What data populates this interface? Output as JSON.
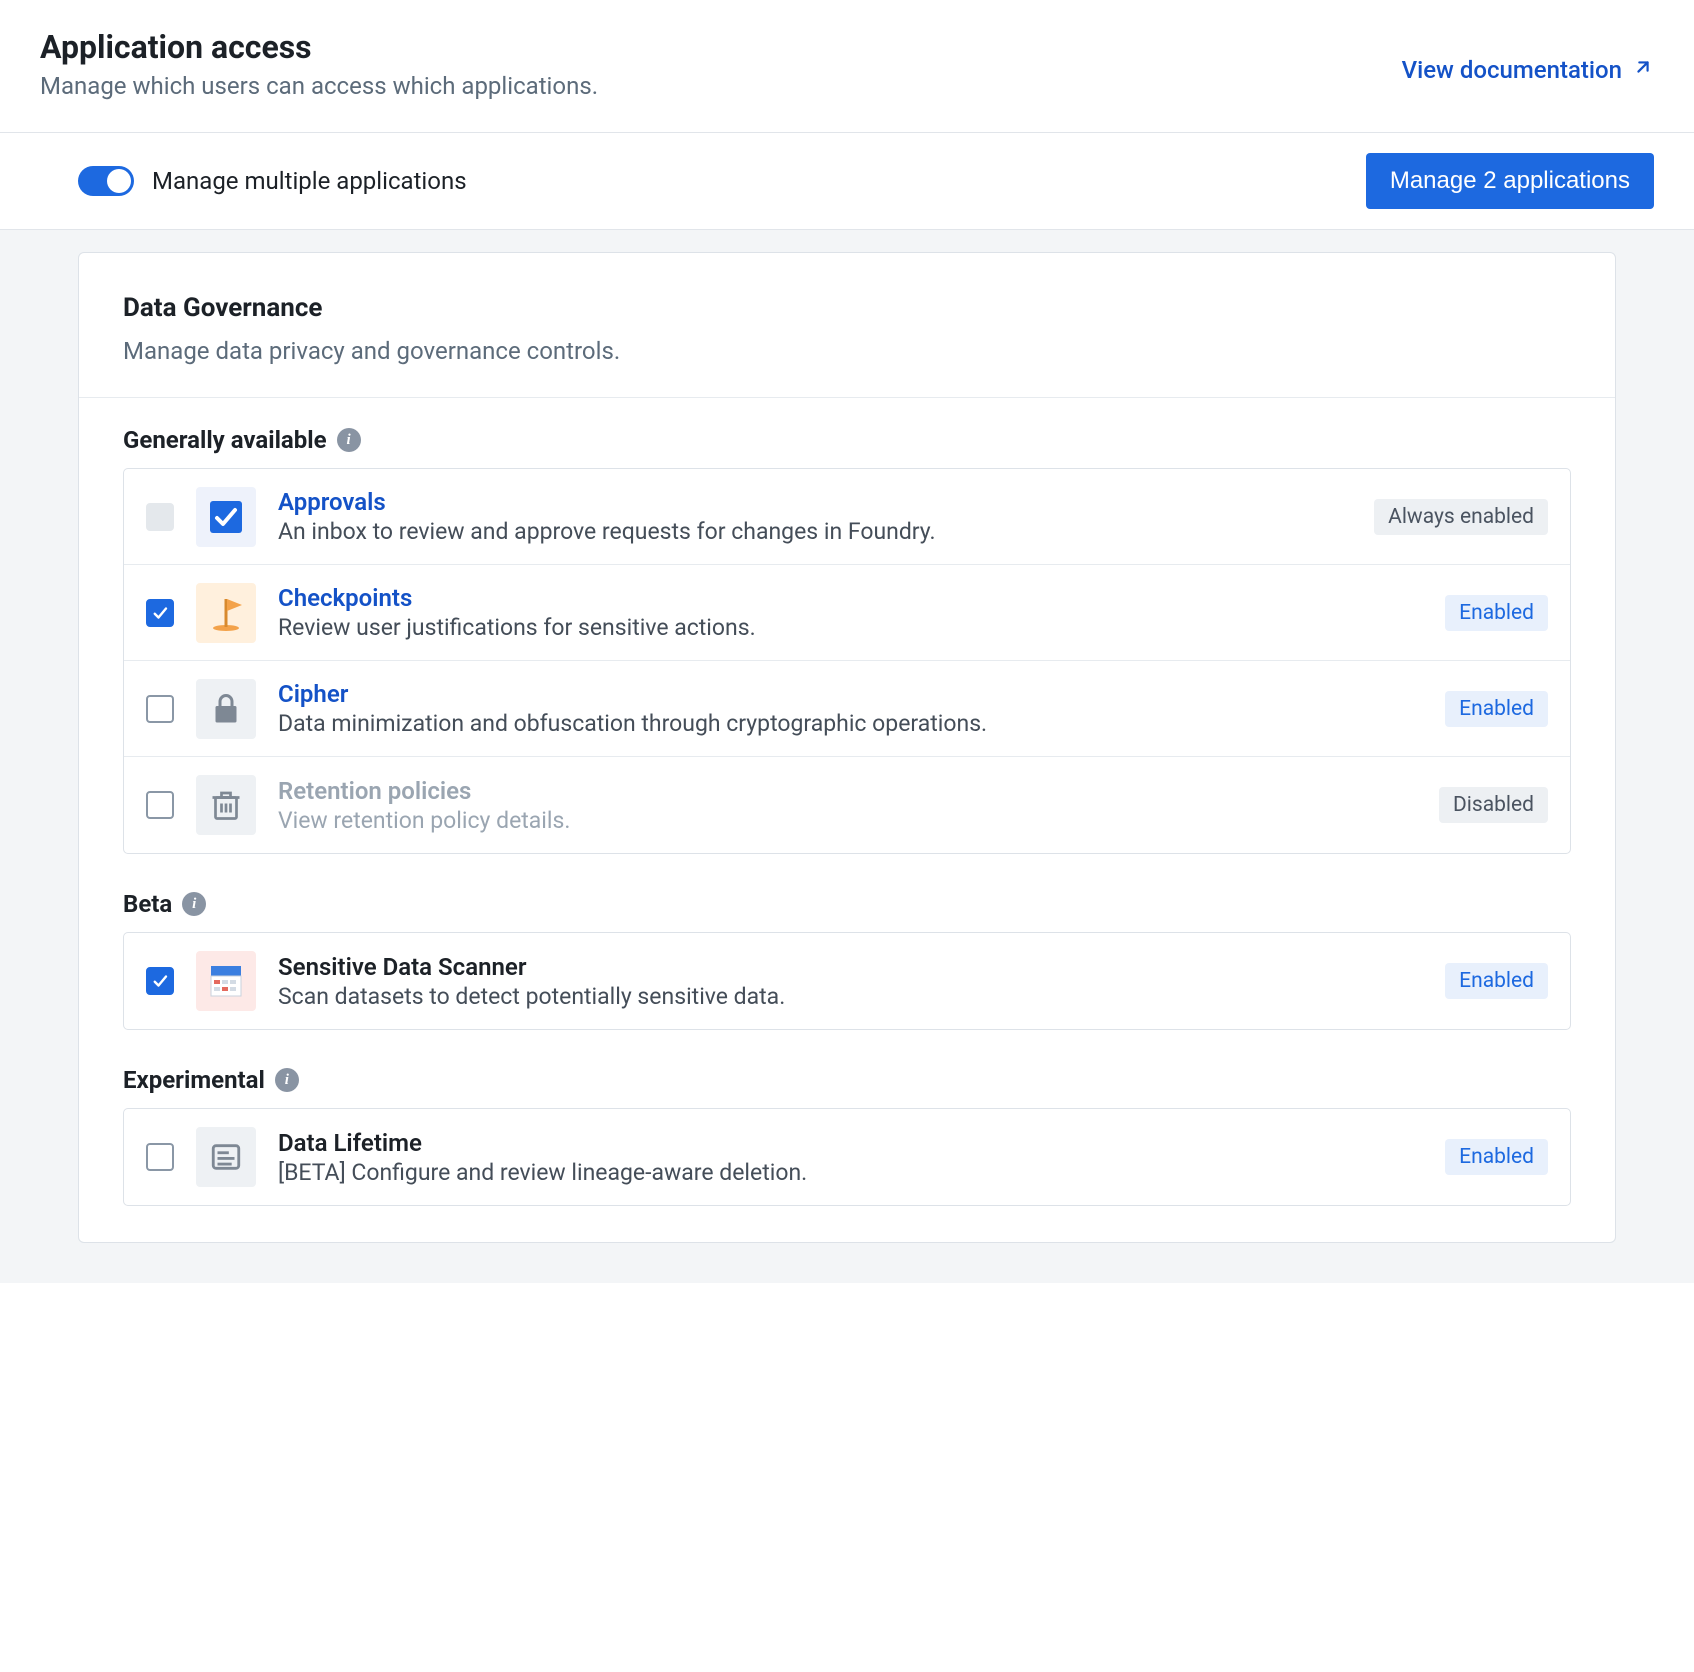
{
  "header": {
    "title": "Application access",
    "subtitle": "Manage which users can access which applications.",
    "doc_link": "View documentation"
  },
  "toolbar": {
    "toggle_label": "Manage multiple applications",
    "manage_btn": "Manage 2 applications"
  },
  "panel": {
    "title": "Data Governance",
    "subtitle": "Manage data privacy and governance controls."
  },
  "sections": {
    "ga": {
      "heading": "Generally available"
    },
    "beta": {
      "heading": "Beta"
    },
    "exp": {
      "heading": "Experimental"
    }
  },
  "apps": {
    "approvals": {
      "title": "Approvals",
      "desc": "An inbox to review and approve requests for changes in Foundry.",
      "badge": "Always enabled"
    },
    "checkpoints": {
      "title": "Checkpoints",
      "desc": "Review user justifications for sensitive actions.",
      "badge": "Enabled"
    },
    "cipher": {
      "title": "Cipher",
      "desc": "Data minimization and obfuscation through cryptographic operations.",
      "badge": "Enabled"
    },
    "retention": {
      "title": "Retention policies",
      "desc": "View retention policy details.",
      "badge": "Disabled"
    },
    "scanner": {
      "title": "Sensitive Data Scanner",
      "desc": "Scan datasets to detect potentially sensitive data.",
      "badge": "Enabled"
    },
    "lifetime": {
      "title": "Data Lifetime",
      "desc": "[BETA] Configure and review lineage-aware deletion.",
      "badge": "Enabled"
    }
  }
}
